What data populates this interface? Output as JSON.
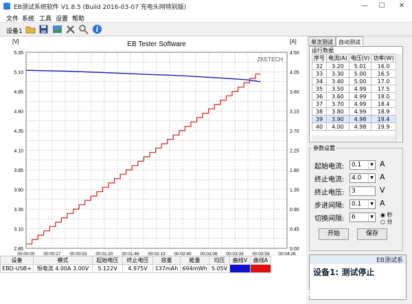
{
  "window": {
    "title": "EB测试系统软件 V1.8.5 (Build 2016-03-07 充电头网特别版)",
    "minimize": "—",
    "maximize": "☐",
    "close": "✕"
  },
  "menu": [
    "文件",
    "系统",
    "工具",
    "设置",
    "帮助"
  ],
  "toolbar": {
    "device": "设备1"
  },
  "chart_data": {
    "type": "line",
    "title": "EB Tester Software",
    "y_left_unit": "[V]",
    "y_right_unit": "[A]",
    "y_left_ticks": [
      "5.35",
      "5.10",
      "4.85",
      "4.60",
      "4.35",
      "4.10",
      "3.85",
      "3.60",
      "3.35",
      "3.10",
      "2.85"
    ],
    "y_right_ticks": [
      "4.50",
      "4.05",
      "3.60",
      "3.15",
      "2.70",
      "2.25",
      "1.80",
      "1.35",
      "0.90",
      "0.45",
      "0.00"
    ],
    "x_ticks": [
      "00:00:00",
      "00:00:27",
      "00:00:53",
      "00:01:20",
      "00:01:46",
      "00:02:13",
      "00:02:40",
      "00:03:06",
      "00:03:33",
      "00:03:59",
      "00:04:26"
    ],
    "ylim_left": [
      2.85,
      5.35
    ],
    "ylim_right": [
      0,
      4.5
    ],
    "xlim_s": [
      0,
      266
    ],
    "brand": "ZKETECH",
    "series": [
      {
        "color": "#1a1aa8",
        "axis": "left",
        "points": [
          [
            0,
            5.12
          ],
          [
            40,
            5.11
          ],
          [
            80,
            5.09
          ],
          [
            120,
            5.07
          ],
          [
            160,
            5.05
          ],
          [
            200,
            5.02
          ],
          [
            225,
            5.0
          ],
          [
            239,
            4.975
          ]
        ]
      },
      {
        "color": "#cc1e1e",
        "axis": "right",
        "steps": [
          [
            0,
            0.1
          ],
          [
            6,
            0.2
          ],
          [
            12,
            0.3
          ],
          [
            18,
            0.4
          ],
          [
            24,
            0.5
          ],
          [
            30,
            0.6
          ],
          [
            36,
            0.7
          ],
          [
            42,
            0.8
          ],
          [
            48,
            0.9
          ],
          [
            54,
            1.0
          ],
          [
            60,
            1.1
          ],
          [
            66,
            1.2
          ],
          [
            72,
            1.3
          ],
          [
            78,
            1.4
          ],
          [
            84,
            1.5
          ],
          [
            90,
            1.6
          ],
          [
            96,
            1.7
          ],
          [
            102,
            1.8
          ],
          [
            108,
            1.9
          ],
          [
            114,
            2.0
          ],
          [
            120,
            2.1
          ],
          [
            126,
            2.2
          ],
          [
            132,
            2.3
          ],
          [
            138,
            2.4
          ],
          [
            144,
            2.5
          ],
          [
            150,
            2.6
          ],
          [
            156,
            2.7
          ],
          [
            162,
            2.8
          ],
          [
            168,
            2.9
          ],
          [
            174,
            3.0
          ],
          [
            180,
            3.1
          ],
          [
            186,
            3.2
          ],
          [
            192,
            3.3
          ],
          [
            198,
            3.4
          ],
          [
            204,
            3.5
          ],
          [
            210,
            3.6
          ],
          [
            216,
            3.7
          ],
          [
            222,
            3.8
          ],
          [
            228,
            3.9
          ],
          [
            234,
            4.0
          ],
          [
            239,
            4.0
          ]
        ]
      }
    ]
  },
  "tabs": [
    "单次测试",
    "自动测试"
  ],
  "run": {
    "caption": "运行数据",
    "headers": [
      "序号",
      "电流(A)",
      "电压(V)",
      "功率(W)"
    ],
    "rows": [
      [
        "32",
        "3.20",
        "5.01",
        "16.0"
      ],
      [
        "33",
        "3.30",
        "5.00",
        "16.5"
      ],
      [
        "34",
        "3.40",
        "5.00",
        "17.0"
      ],
      [
        "35",
        "3.50",
        "4.99",
        "17.5"
      ],
      [
        "36",
        "3.60",
        "4.99",
        "18.0"
      ],
      [
        "37",
        "3.70",
        "4.99",
        "18.4"
      ],
      [
        "38",
        "3.80",
        "4.99",
        "18.9"
      ],
      [
        "39",
        "3.90",
        "4.98",
        "19.4"
      ],
      [
        "40",
        "4.00",
        "4.98",
        "19.9"
      ]
    ]
  },
  "params": {
    "caption": "参数设置",
    "start_label": "起始电流:",
    "start_val": "0.1",
    "start_unit": "A",
    "stop_label": "终止电流:",
    "stop_val": "4.0",
    "stop_unit": "A",
    "stopv_label": "终止电压:",
    "stopv_val": "3",
    "stopv_unit": "V",
    "step_label": "步进间隔:",
    "step_val": "0.1",
    "step_unit": "A",
    "switch_label": "切换间隔:",
    "switch_val": "6",
    "sec": "秒",
    "min": "分",
    "start_btn": "开始",
    "save_btn": "保存"
  },
  "bottom": {
    "headers": [
      "设备",
      "模式",
      "起始电压",
      "终止电压",
      "容量",
      "能量",
      "均压",
      "曲线V",
      "曲线A"
    ],
    "row": [
      "EBD-USB+",
      "恒电流 4.00A 3.00V",
      "5.122V",
      "4.975V",
      "137mAh",
      "694mWh",
      "5.05V"
    ],
    "curve_v_color": "#1010d0",
    "curve_a_color": "#e01010"
  },
  "status": {
    "header": "EB测试系",
    "message": "设备1: 测试停止"
  },
  "watermark": "值 什么值得买"
}
